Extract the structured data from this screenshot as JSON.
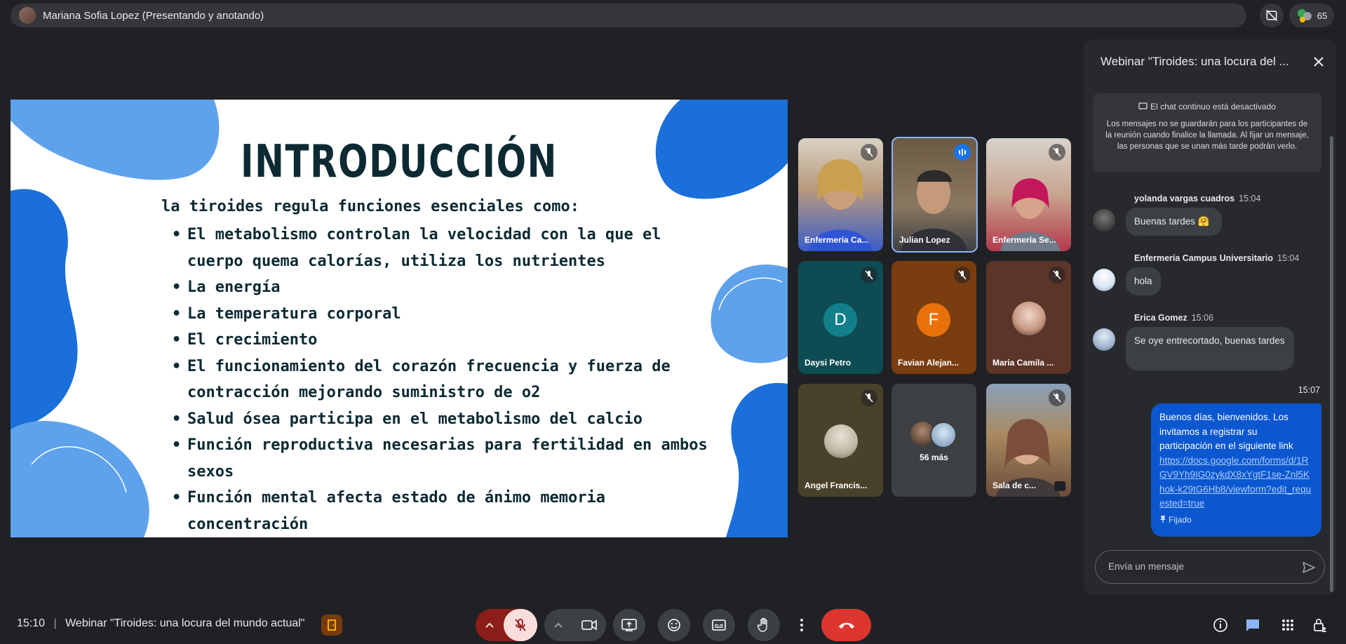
{
  "presenter": {
    "name": "Mariana Sofia Lopez (Presentando y anotando)"
  },
  "top_right": {
    "participant_count": "65"
  },
  "slide": {
    "title": "INTRODUCCIÓN",
    "intro": "la tiroides regula funciones esenciales como:",
    "bullets": [
      "El metabolismo controlan la velocidad con la que el cuerpo quema calorías, utiliza los nutrientes",
      "La energía",
      "La temperatura corporal",
      "El crecimiento",
      "El funcionamiento del corazón frecuencia y fuerza de contracción mejorando suministro de o2",
      "Salud ósea participa en el metabolismo del calcio",
      "Función reproductiva necesarias para fertilidad en ambos sexos",
      "Función mental afecta estado de ánimo memoria concentración"
    ],
    "colors": {
      "blob_dark": "#1a6fdb",
      "blob_light": "#5fa2ec",
      "text": "#0d2a33"
    }
  },
  "participants": [
    {
      "name": "Enfermería Ca...",
      "muted": true
    },
    {
      "name": "Julian Lopez",
      "muted": false,
      "speaking": true
    },
    {
      "name": "Enfermería Se...",
      "muted": true
    },
    {
      "name": "Daysi Petro",
      "muted": true,
      "initial": "D",
      "color": "#12808b"
    },
    {
      "name": "Favian Alejan...",
      "muted": true,
      "initial": "F",
      "color": "#e8710a"
    },
    {
      "name": "Maria Camila ...",
      "muted": true
    },
    {
      "name": "Angel Francis...",
      "muted": true
    },
    {
      "more_label": "56 más"
    },
    {
      "name": "Sala de c...",
      "muted": true
    }
  ],
  "chat": {
    "title": "Webinar \"Tiroides: una locura del ...",
    "notice_title": "El chat continuo está desactivado",
    "notice_body": "Los mensajes no se guardarán para los participantes de la reunión cuando finalice la llamada. Al fijar un mensaje, las personas que se unan más tarde podrán verlo.",
    "messages": [
      {
        "sender": "yolanda vargas cuadros",
        "time": "15:04",
        "text": "Buenas tardes 🤗"
      },
      {
        "sender": "Enfermería Campus Universitario",
        "time": "15:04",
        "text": "hola"
      },
      {
        "sender": "Erica Gomez",
        "time": "15:06",
        "text": "Se oye entrecortado,  buenas tardes"
      }
    ],
    "own_message": {
      "time": "15:07",
      "text": "Buenos días, bienvenidos. Los invitamos a registrar su participación en el siguiente link",
      "link": "https://docs.google.com/forms/d/1RGV9Yh9IG0zykdX8xYgtF1se-Znl5Khok-k29tG6Hb8/viewform?edit_requested=true",
      "pinned_label": "Fijado"
    },
    "input_placeholder": "Envía un mensaje"
  },
  "bottom": {
    "time": "15:10",
    "separator": "|",
    "meeting_title": "Webinar \"Tiroides: una locura del mundo actual\""
  }
}
